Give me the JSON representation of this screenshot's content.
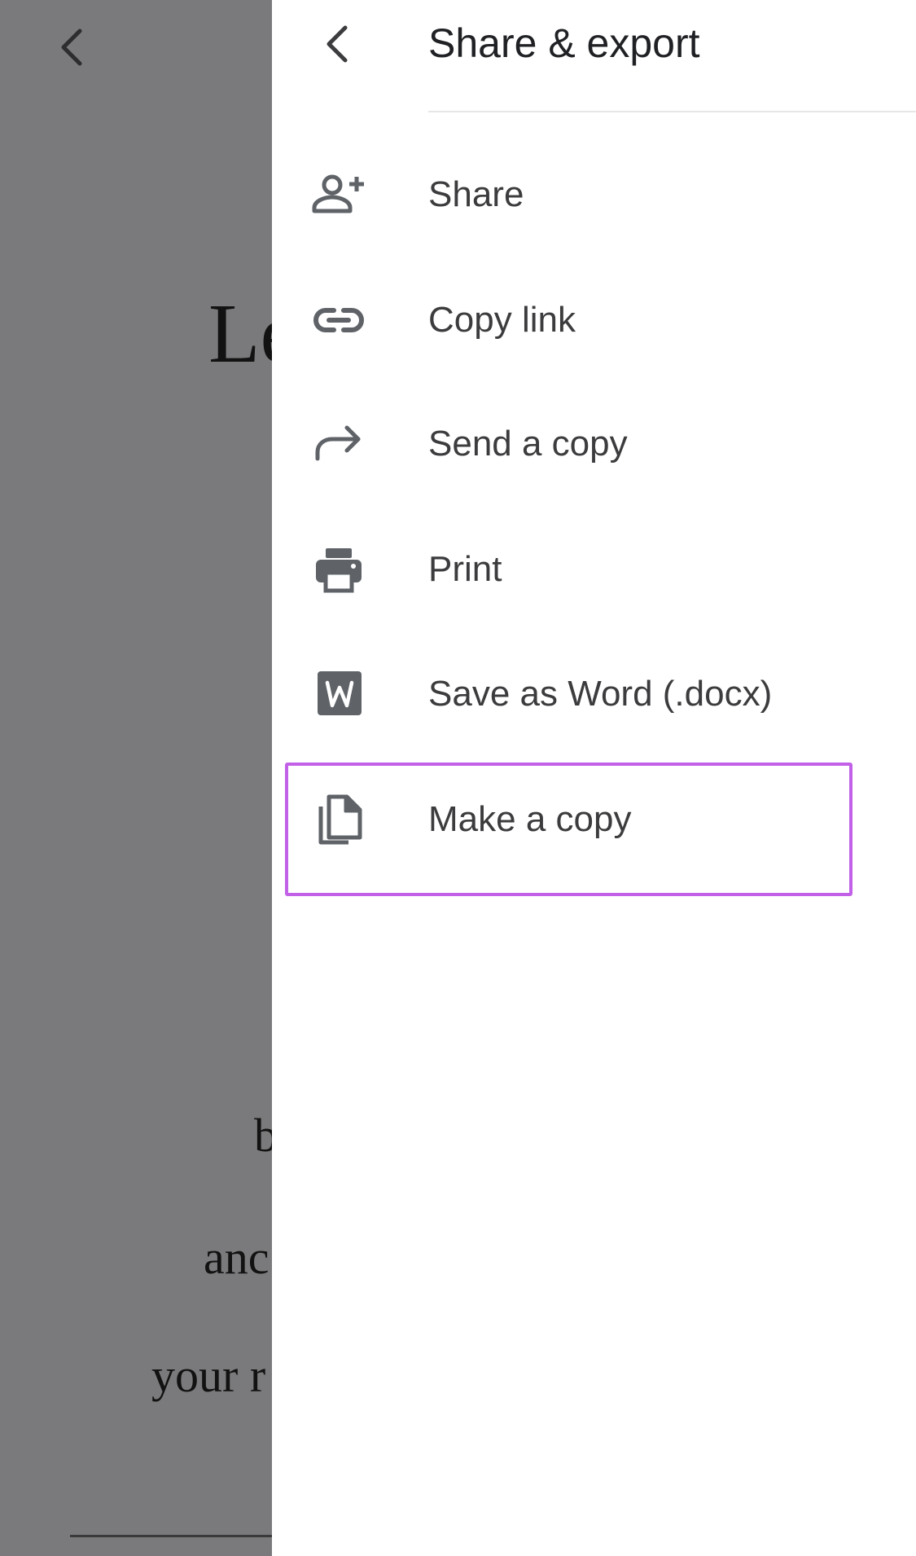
{
  "document": {
    "title_fragment": "Le",
    "lines": [
      "b",
      "anc",
      "your r"
    ]
  },
  "panel": {
    "title": "Share & export",
    "back_icon": "chevron-left-icon",
    "items": [
      {
        "label": "Share",
        "icon": "person-add-icon"
      },
      {
        "label": "Copy link",
        "icon": "link-icon"
      },
      {
        "label": "Send a copy",
        "icon": "forward-arrow-icon"
      },
      {
        "label": "Print",
        "icon": "printer-icon"
      },
      {
        "label": "Save as Word (.docx)",
        "icon": "word-icon"
      },
      {
        "label": "Make a copy",
        "icon": "copy-icon"
      }
    ]
  },
  "colors": {
    "highlight": "#c261e8",
    "icon": "#5f6368",
    "overlay": "#7a7a7c"
  }
}
